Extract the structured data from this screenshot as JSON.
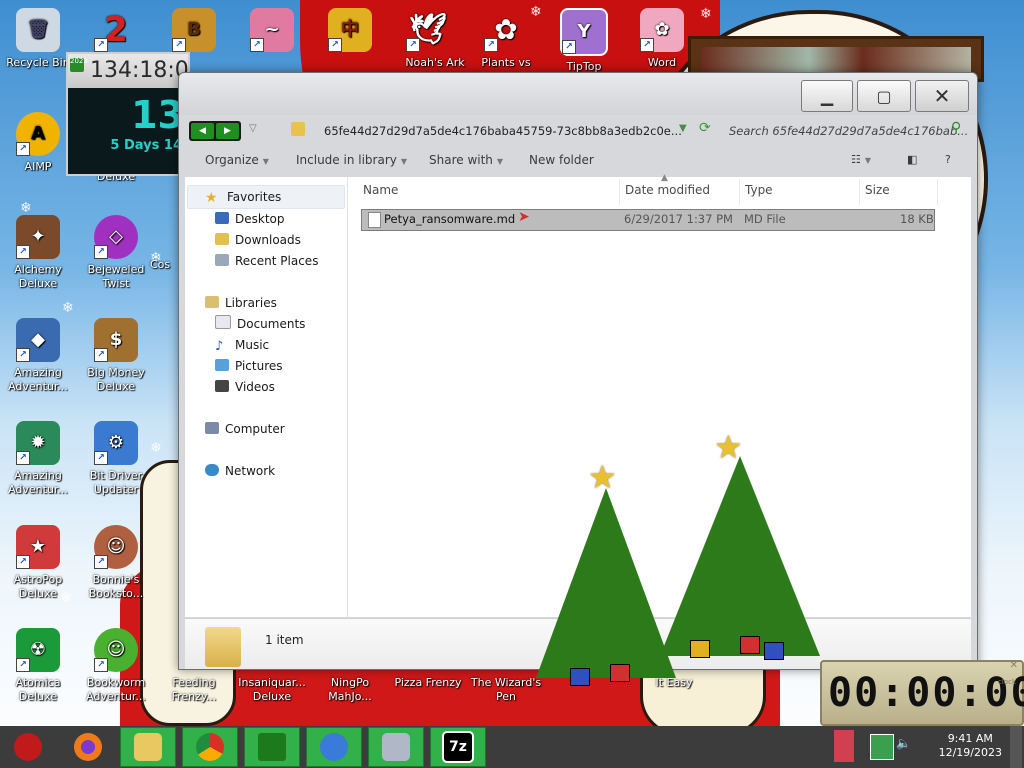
{
  "desktop": {
    "icons": [
      {
        "label": "Recycle Bin",
        "color": "#9fb7cf",
        "glyph": "🗑"
      },
      {
        "label": "AIMP",
        "color": "#f0b400",
        "glyph": "A"
      },
      {
        "label": "Alchemy\nDeluxe",
        "color": "#7a4a2a",
        "glyph": "✦"
      },
      {
        "label": "Amazing\nAdventur...",
        "color": "#3a6ab0",
        "glyph": "◆"
      },
      {
        "label": "Amazing\nAdventur...",
        "color": "#2a8a5a",
        "glyph": "✹"
      },
      {
        "label": "AstroPop\nDeluxe",
        "color": "#d03a3a",
        "glyph": "★"
      },
      {
        "label": "Atomica\nDeluxe",
        "color": "#1b9a3a",
        "glyph": "☢"
      },
      {
        "label": "Deluxe",
        "color": "#d04040",
        "glyph": "2"
      },
      {
        "label": "Bejeweled\nTwist",
        "color": "#a030c0",
        "glyph": "◇"
      },
      {
        "label": "Big Money\nDeluxe",
        "color": "#a07030",
        "glyph": "$"
      },
      {
        "label": "Bit Driver\nUpdater",
        "color": "#3a7ad0",
        "glyph": "⚙"
      },
      {
        "label": "Bonnie's\nBooksto...",
        "color": "#b06040",
        "glyph": "☺"
      },
      {
        "label": "Bookworm\nAdventur...",
        "color": "#4ab030",
        "glyph": "☺"
      },
      {
        "label": "Feeding\nFrenzy...",
        "color": "#e07a20",
        "glyph": "~"
      },
      {
        "label": "Insaniquar...\nDeluxe",
        "color": "#3a8ad0",
        "glyph": "✿"
      },
      {
        "label": "NingPo\nMahJo...",
        "color": "#c03030",
        "glyph": "中"
      },
      {
        "label": "Pizza Frenzy",
        "color": "#e0a030",
        "glyph": "◐"
      },
      {
        "label": "The Wizard's\nPen",
        "color": "#6a40a0",
        "glyph": "✎"
      },
      {
        "label": "Noah's Ark",
        "color": "#d02020",
        "glyph": "✈"
      },
      {
        "label": "Plants vs",
        "color": "#c02020",
        "glyph": "✿"
      },
      {
        "label": "TipTop",
        "color": "#a070d0",
        "glyph": "Y"
      },
      {
        "label": "Word",
        "color": "#e07090",
        "glyph": "✿"
      },
      {
        "label": "Cos",
        "color": "#d04040",
        "glyph": "C"
      },
      {
        "label": "It Easy",
        "color": "#2a6ad0",
        "glyph": "E"
      }
    ]
  },
  "gadget_clock": {
    "top_text": "134:18:07  Christmas",
    "mini": "2023",
    "big": "13",
    "sub": "5 Days 14"
  },
  "explorer": {
    "address": "65fe44d27d29d7a5de4c176baba45759-73c8bb8a3edb2c0e...",
    "search_placeholder": "Search 65fe44d27d29d7a5de4c176bab...",
    "toolbar": {
      "organize": "Organize",
      "include": "Include in library",
      "share": "Share with",
      "new_folder": "New folder"
    },
    "nav": {
      "favorites": "Favorites",
      "desktop": "Desktop",
      "downloads": "Downloads",
      "recent": "Recent Places",
      "libraries": "Libraries",
      "documents": "Documents",
      "music": "Music",
      "pictures": "Pictures",
      "videos": "Videos",
      "computer": "Computer",
      "network": "Network"
    },
    "columns": {
      "name": "Name",
      "date": "Date modified",
      "type": "Type",
      "size": "Size"
    },
    "files": [
      {
        "name": "Petya_ransomware.md",
        "date": "6/29/2017 1:37 PM",
        "type": "MD File",
        "size": "18 KB"
      }
    ],
    "status": "1 item"
  },
  "counter_gadget": {
    "digits": "00:00:00",
    "brand": "clock"
  },
  "taskbar": {
    "time": "9:41 AM",
    "date": "12/19/2023",
    "apps": [
      "santa-start",
      "firefox",
      "file-explorer",
      "chrome",
      "christmas-tree",
      "shield",
      "bit-driver",
      "7zip"
    ]
  }
}
